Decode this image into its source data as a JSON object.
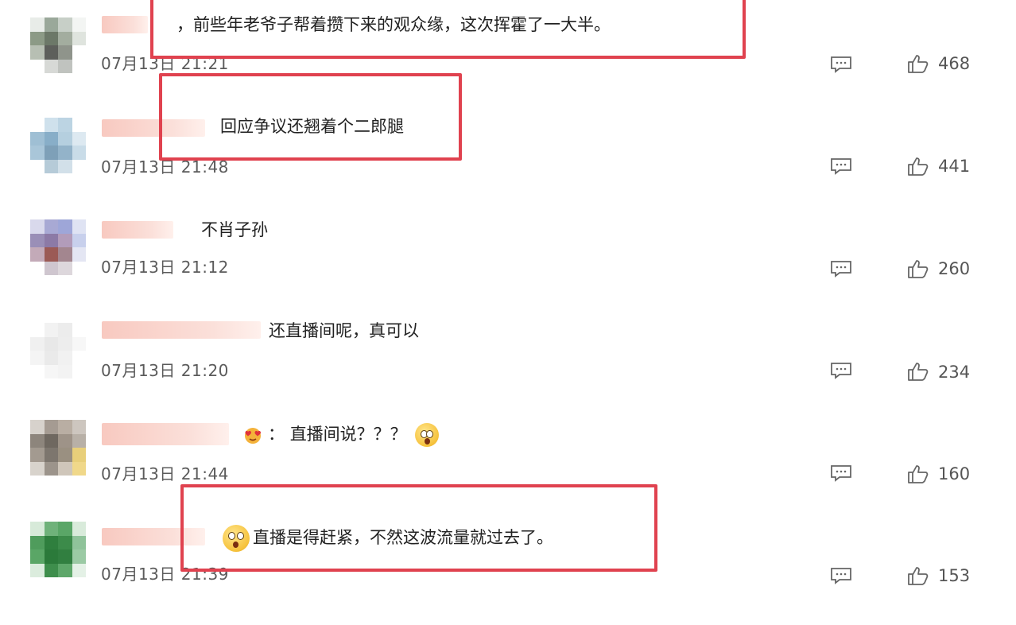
{
  "comments": [
    {
      "text": "，前些年老爷子帮着攒下来的观众缘，这次挥霍了一大半。",
      "time": "07月13日 21:21",
      "likes": "468"
    },
    {
      "text": "回应争议还翘着个二郎腿",
      "time": "07月13日 21:48",
      "likes": "441"
    },
    {
      "text": "不肖子孙",
      "time": "07月13日 21:12",
      "likes": "260"
    },
    {
      "text": "还直播间呢，真可以",
      "time": "07月13日 21:20",
      "likes": "234"
    },
    {
      "text_prefix": "：",
      "text": "直播间说？？？",
      "time": "07月13日 21:44",
      "likes": "160"
    },
    {
      "text": "直播是得赶紧，不然这波流量就过去了。",
      "time": "07月13日 21:39",
      "likes": "153"
    }
  ],
  "icons": {
    "reply": "comment-bubble-icon",
    "like": "thumbs-up-icon"
  },
  "colors": {
    "highlight_box": "#e0424f",
    "time_text": "#5b5b5b",
    "nickname_blur": "#f8c9c0"
  }
}
